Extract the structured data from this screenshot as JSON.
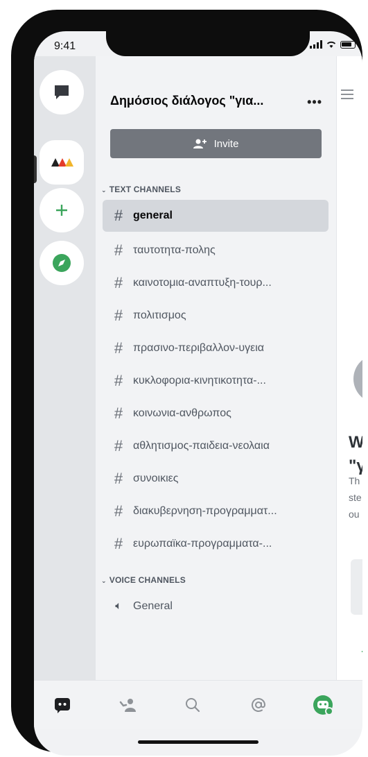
{
  "status_bar": {
    "time": "9:41"
  },
  "server": {
    "name": "Δημόσιος διάλογος \"για...",
    "more": "•••",
    "invite_label": "Invite"
  },
  "sections": {
    "text": "TEXT CHANNELS",
    "voice": "VOICE CHANNELS"
  },
  "text_channels": [
    {
      "name": "general",
      "active": true
    },
    {
      "name": "ταυτοτητα-πολης"
    },
    {
      "name": "καινοτομια-αναπτυξη-τουρ..."
    },
    {
      "name": "πολιτισμος"
    },
    {
      "name": "πρασινο-περιβαλλον-υγεια"
    },
    {
      "name": "κυκλοφορια-κινητικοτητα-..."
    },
    {
      "name": "κοινωνια-ανθρωπος"
    },
    {
      "name": "αθλητισμος-παιδεια-νεολαια"
    },
    {
      "name": "συνοικιες"
    },
    {
      "name": "διακυβερνηση-προγραμματ..."
    },
    {
      "name": "ευρωπαϊκα-προγραμματα-..."
    }
  ],
  "voice_channels": [
    {
      "name": "General"
    }
  ],
  "peek": {
    "big_line1": "W",
    "big_line2": "\"γ",
    "small_line1": "Th",
    "small_line2": "ste",
    "small_line3": "ou"
  },
  "colors": {
    "accent_green": "#3ba55c",
    "invite_bg": "#72767d",
    "active_channel_bg": "#d4d7dc",
    "compass_green": "#3ba55c"
  },
  "tabs": [
    "home-tab",
    "friends-tab",
    "search-tab",
    "mentions-tab",
    "profile-tab"
  ]
}
